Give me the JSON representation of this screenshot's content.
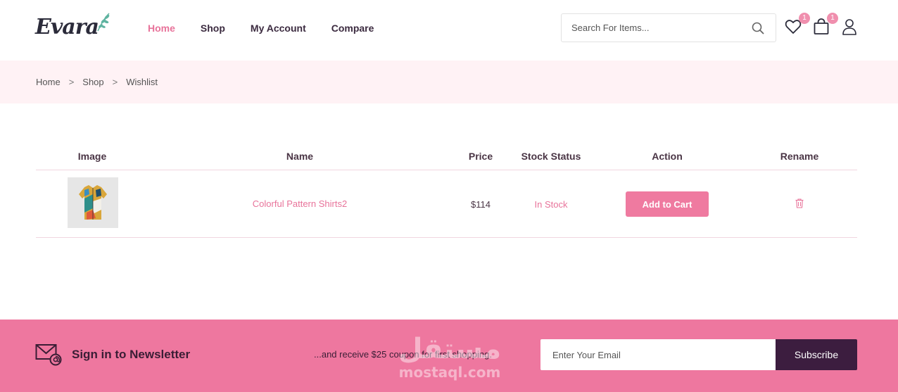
{
  "header": {
    "logo_text": "Evara",
    "nav": [
      {
        "label": "Home",
        "active": true
      },
      {
        "label": "Shop",
        "active": false
      },
      {
        "label": "My Account",
        "active": false
      },
      {
        "label": "Compare",
        "active": false
      }
    ],
    "search_placeholder": "Search For Items...",
    "wishlist_count": "1",
    "cart_count": "1",
    "icons": [
      "search-icon",
      "heart-icon",
      "shopping-bag-icon",
      "user-icon"
    ]
  },
  "breadcrumb": {
    "items": [
      "Home",
      "Shop",
      "Wishlist"
    ],
    "separator": ">"
  },
  "table": {
    "columns": [
      "Image",
      "Name",
      "Price",
      "Stock Status",
      "Action",
      "Rename"
    ],
    "rows": [
      {
        "name": "Colorful Pattern Shirts2",
        "price": "$114",
        "stock": "In Stock",
        "action_label": "Add to Cart"
      }
    ]
  },
  "newsletter": {
    "title": "Sign in to Newsletter",
    "subtitle": "...and receive $25 coupon for first shopping.",
    "email_placeholder": "Enter Your Email",
    "button_label": "Subscribe",
    "watermark_ar": "مستقل",
    "watermark_en": "mostaql.com"
  },
  "colors": {
    "accent": "#e8739a",
    "dark": "#3c1d3f",
    "breadcrumb_bg": "#fff2f5",
    "footer_bg": "#ee779f"
  }
}
